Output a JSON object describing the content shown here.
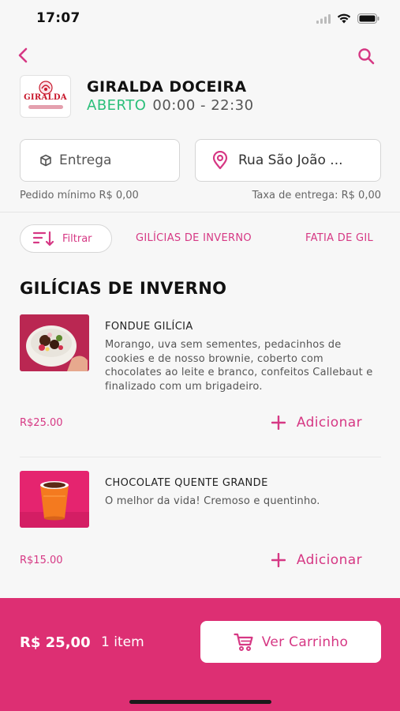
{
  "status_bar": {
    "time": "17:07"
  },
  "store": {
    "name": "GIRALDA DOCEIRA",
    "status": "ABERTO",
    "hours": "00:00 - 22:30",
    "logo_text": "GIRALDA"
  },
  "selectors": {
    "delivery_label": "Entrega",
    "address_label": "Rua São João ..."
  },
  "info": {
    "min_order": "Pedido mínimo R$ 0,00",
    "delivery_fee": "Taxa de entrega: R$ 0,00"
  },
  "categories": {
    "filter_label": "Filtrar",
    "tabs": [
      "GILÍCIAS DE INVERNO",
      "FATIA DE GIL"
    ]
  },
  "section": {
    "title": "GILÍCIAS DE INVERNO"
  },
  "products": [
    {
      "name": "FONDUE GILÍCIA",
      "description": "Morango, uva sem sementes, pedacinhos de cookies e de nosso brownie, coberto com chocolates ao leite e branco, confeitos Callebaut e finalizado com um brigadeiro.",
      "price": "R$25.00",
      "add_label": "Adicionar"
    },
    {
      "name": "CHOCOLATE QUENTE GRANDE",
      "description": "O melhor da vida! Cremoso e quentinho.",
      "price": "R$15.00",
      "add_label": "Adicionar"
    }
  ],
  "cart": {
    "total": "R$ 25,00",
    "count": "1 item",
    "button_label": "Ver Carrinho"
  },
  "colors": {
    "accent": "#dd2f73",
    "open_green": "#2bbf7a"
  }
}
